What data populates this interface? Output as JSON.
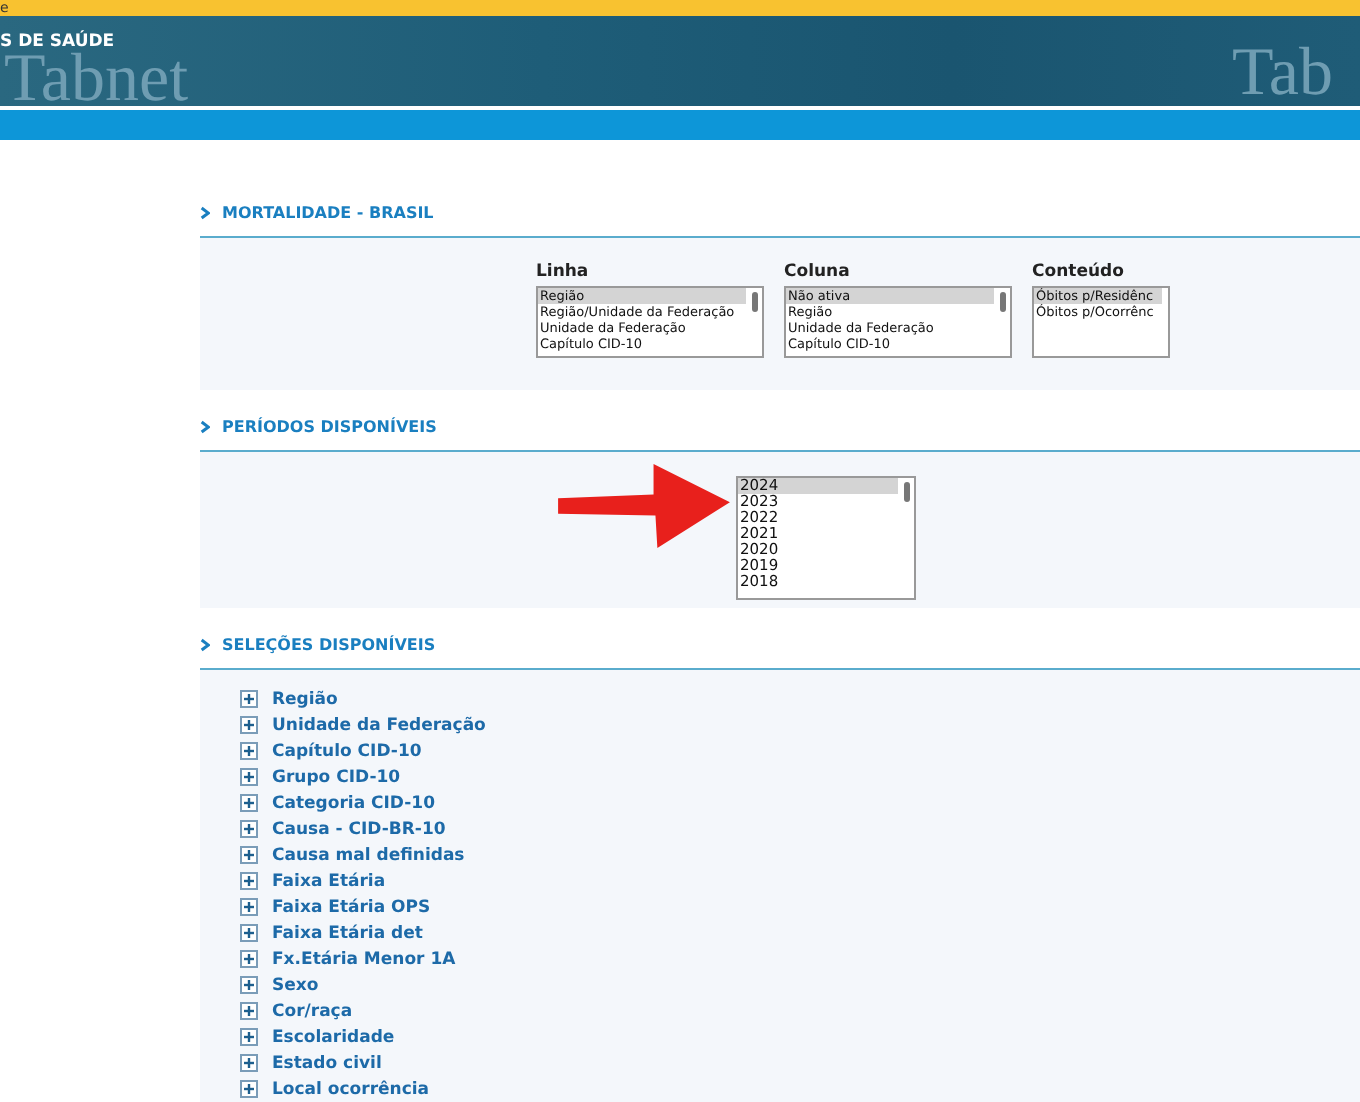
{
  "top_bar": {
    "text": "e"
  },
  "banner": {
    "title": "S DE SAÚDE",
    "logo_texts": [
      "Tabnet",
      "Tab"
    ]
  },
  "sections": [
    {
      "title": "MORTALIDADE - BRASIL",
      "kind": "selectors",
      "selectors": [
        {
          "label": "Linha",
          "items": [
            {
              "text": "Região",
              "selected": true
            },
            {
              "text": "Região/Unidade da Federação",
              "selected": false
            },
            {
              "text": "Unidade da Federação",
              "selected": false
            },
            {
              "text": "Capítulo CID-10",
              "selected": false
            }
          ]
        },
        {
          "label": "Coluna",
          "items": [
            {
              "text": "Não ativa",
              "selected": true
            },
            {
              "text": "Região",
              "selected": false
            },
            {
              "text": "Unidade da Federação",
              "selected": false
            },
            {
              "text": "Capítulo CID-10",
              "selected": false
            }
          ]
        },
        {
          "label": "Conteúdo",
          "items": [
            {
              "text": "Óbitos p/Residênc",
              "selected": true
            },
            {
              "text": "Óbitos p/Ocorrênc",
              "selected": false
            }
          ]
        }
      ]
    },
    {
      "title": "PERÍODOS DISPONÍVEIS",
      "kind": "periods",
      "arrow": true,
      "items": [
        {
          "text": "2024",
          "selected": true
        },
        {
          "text": "2023",
          "selected": false
        },
        {
          "text": "2022",
          "selected": false
        },
        {
          "text": "2021",
          "selected": false
        },
        {
          "text": "2020",
          "selected": false
        },
        {
          "text": "2019",
          "selected": false
        },
        {
          "text": "2018",
          "selected": false
        }
      ]
    },
    {
      "title": "SELEÇÕES DISPONÍVEIS",
      "kind": "tree",
      "items": [
        {
          "label": "Região",
          "expanded": false
        },
        {
          "label": "Unidade da Federação",
          "expanded": false
        },
        {
          "label": "Capítulo CID-10",
          "expanded": false
        },
        {
          "label": "Grupo CID-10",
          "expanded": false
        },
        {
          "label": "Categoria CID-10",
          "expanded": false
        },
        {
          "label": "Causa - CID-BR-10",
          "expanded": false
        },
        {
          "label": "Causa mal definidas",
          "expanded": false
        },
        {
          "label": "Faixa Etária",
          "expanded": false
        },
        {
          "label": "Faixa Etária OPS",
          "expanded": false
        },
        {
          "label": "Faixa Etária det",
          "expanded": false
        },
        {
          "label": "Fx.Etária Menor 1A",
          "expanded": false
        },
        {
          "label": "Sexo",
          "expanded": false
        },
        {
          "label": "Cor/raça",
          "expanded": false
        },
        {
          "label": "Escolaridade",
          "expanded": false
        },
        {
          "label": "Estado civil",
          "expanded": false
        },
        {
          "label": "Local ocorrência",
          "expanded": false
        }
      ]
    }
  ]
}
